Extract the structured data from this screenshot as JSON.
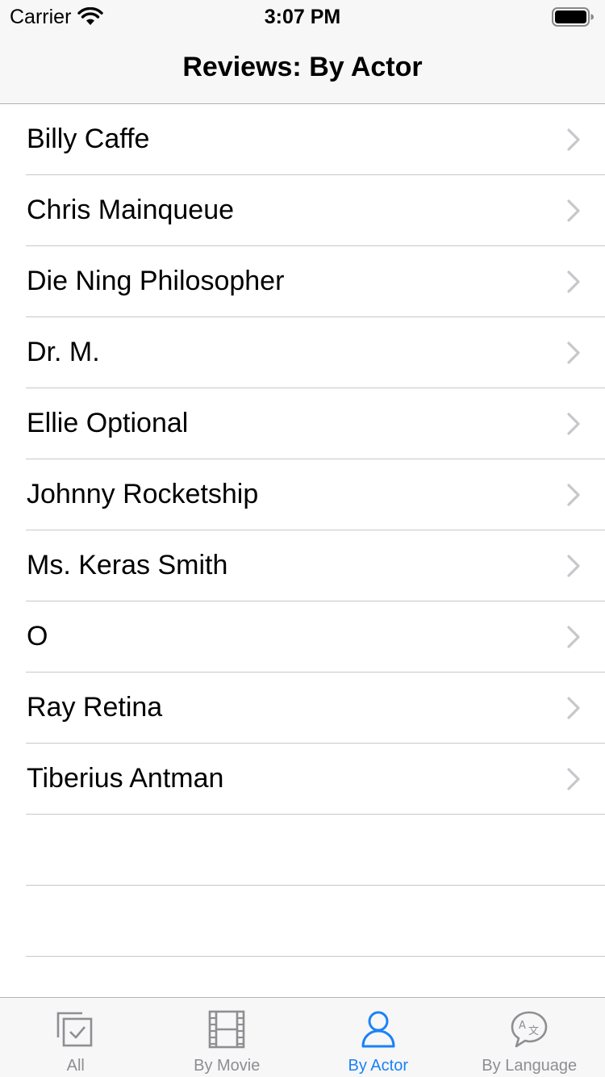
{
  "status_bar": {
    "carrier": "Carrier",
    "time": "3:07 PM"
  },
  "nav": {
    "title": "Reviews: By Actor"
  },
  "list": {
    "items": [
      {
        "label": "Billy Caffe"
      },
      {
        "label": "Chris Mainqueue"
      },
      {
        "label": "Die Ning Philosopher"
      },
      {
        "label": "Dr. M."
      },
      {
        "label": "Ellie Optional"
      },
      {
        "label": "Johnny Rocketship"
      },
      {
        "label": "Ms. Keras Smith"
      },
      {
        "label": "O"
      },
      {
        "label": "Ray Retina"
      },
      {
        "label": "Tiberius Antman"
      },
      {
        "label": ""
      },
      {
        "label": ""
      }
    ]
  },
  "tab_bar": {
    "tabs": [
      {
        "label": "All",
        "icon": "checklist-icon",
        "active": false
      },
      {
        "label": "By Movie",
        "icon": "film-icon",
        "active": false
      },
      {
        "label": "By Actor",
        "icon": "person-icon",
        "active": true
      },
      {
        "label": "By Language",
        "icon": "translate-bubble-icon",
        "active": false
      }
    ]
  },
  "colors": {
    "accent": "#1a82f7",
    "inactive": "#8e8e93",
    "bar_background": "#f7f7f7",
    "separator": "#c8c7cc"
  }
}
